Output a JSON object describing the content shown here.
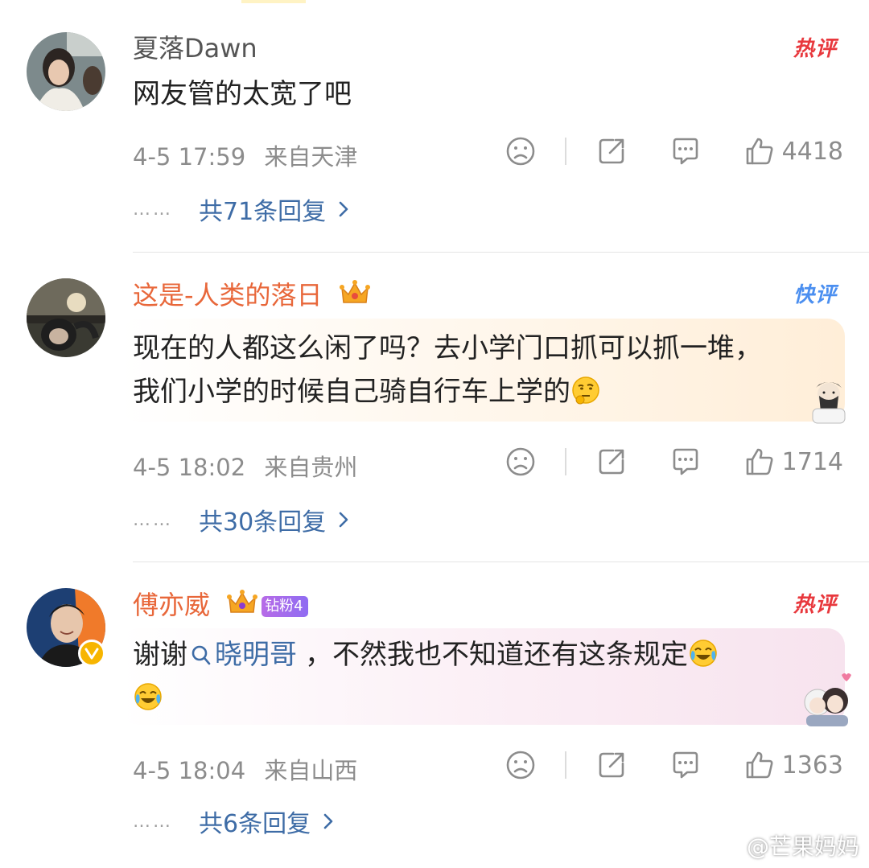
{
  "comments": [
    {
      "username": "夏落Dawn",
      "tag": "热评",
      "text_lines": [
        "网友管的太宽了吧"
      ],
      "time": "4-5 17:59",
      "location": "来自天津",
      "likes": "4418",
      "replies": "共71条回复",
      "dots": "……"
    },
    {
      "username": "这是-人类的落日",
      "tag": "快评",
      "text_lines": [
        "现在的人都这么闲了吗？去小学门口抓可以抓一堆，",
        "我们小学的时候自己骑自行车上学的"
      ],
      "time": "4-5 18:02",
      "location": "来自贵州",
      "likes": "1714",
      "replies": "共30条回复",
      "dots": "……"
    },
    {
      "username": "傅亦威",
      "fan_badge": "钻粉4",
      "tag": "热评",
      "text_prefix": "谢谢",
      "mention": "晓明哥",
      "text_suffix": "，不然我也不知道还有这条规定",
      "time": "4-5 18:04",
      "location": "来自山西",
      "likes": "1363",
      "replies": "共6条回复",
      "dots": "……"
    }
  ],
  "watermark": "@芒果妈妈",
  "icons": {
    "dislike": "sad-face-icon",
    "share": "share-icon",
    "comment": "comment-icon",
    "like": "thumbs-up-icon",
    "chevron": "chevron-right-icon",
    "search": "search-icon",
    "crown": "crown-icon",
    "verified": "verified-v-icon"
  },
  "colors": {
    "link": "#3e6ca6",
    "vip_name": "#e8673a",
    "hot_tag": "#e8383d",
    "fast_tag": "#4b8ff0",
    "meta": "#8c8c8c"
  }
}
